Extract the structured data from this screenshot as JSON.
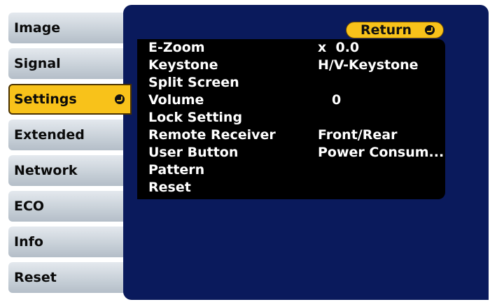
{
  "sidebar": {
    "items": [
      {
        "label": "Image"
      },
      {
        "label": "Signal"
      },
      {
        "label": "Settings"
      },
      {
        "label": "Extended"
      },
      {
        "label": "Network"
      },
      {
        "label": "ECO"
      },
      {
        "label": "Info"
      },
      {
        "label": "Reset"
      }
    ],
    "active_index": 2
  },
  "panel": {
    "return_label": "Return",
    "rows": [
      {
        "label": "E-Zoom",
        "value": "x  0.0"
      },
      {
        "label": "Keystone",
        "value": "H/V-Keystone"
      },
      {
        "label": "Split Screen",
        "value": ""
      },
      {
        "label": "Volume",
        "value": "0"
      },
      {
        "label": "Lock Setting",
        "value": ""
      },
      {
        "label": "Remote Receiver",
        "value": "Front/Rear"
      },
      {
        "label": "User Button",
        "value": "Power Consum..."
      },
      {
        "label": "Pattern",
        "value": ""
      },
      {
        "label": "Reset",
        "value": ""
      }
    ]
  },
  "colors": {
    "panel_blue": "#0a1a5c",
    "highlight_yellow": "#f8c21a",
    "list_black": "#000000"
  }
}
